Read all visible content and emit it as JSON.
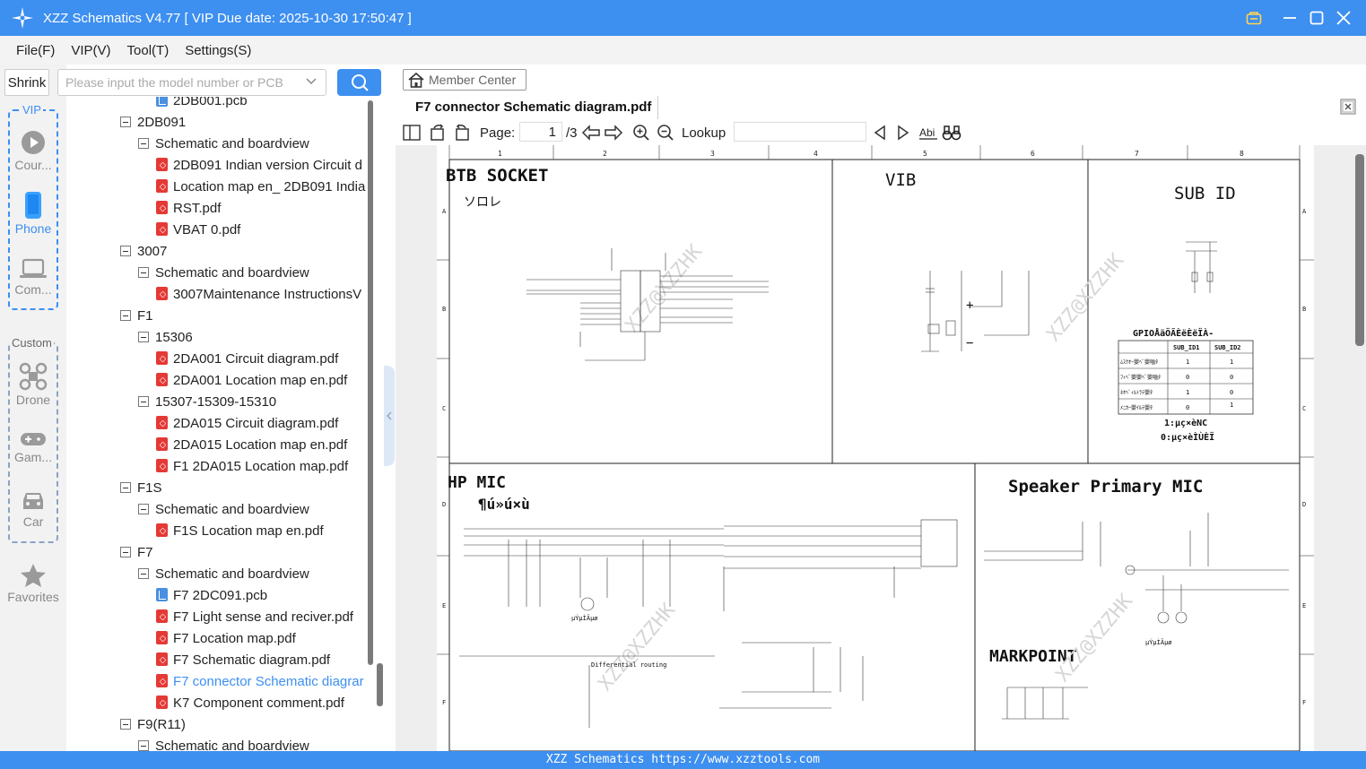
{
  "app": {
    "title": "XZZ Schematics V4.77 [ VIP Due date: 2025-10-30 17:50:47 ]",
    "status_text": "XZZ Schematics https://www.xzztools.com"
  },
  "menu": [
    "File(F)",
    "VIP(V)",
    "Tool(T)",
    "Settings(S)"
  ],
  "search": {
    "shrink_label": "Shrink",
    "placeholder": "Please input the model number or PCB"
  },
  "rail": {
    "vip_label": "VIP",
    "custom_label": "Custom",
    "items": [
      {
        "label": "Cour...",
        "icon": "play-icon"
      },
      {
        "label": "Phone",
        "icon": "phone-icon"
      },
      {
        "label": "Com...",
        "icon": "laptop-icon"
      },
      {
        "label": "Drone",
        "icon": "drone-icon"
      },
      {
        "label": "Gam...",
        "icon": "gamepad-icon"
      },
      {
        "label": "Car",
        "icon": "car-icon"
      },
      {
        "label": "Favorites",
        "icon": "star-icon"
      }
    ]
  },
  "tree": [
    {
      "label": "2DB001.pcb",
      "level": 2,
      "type": "pcb"
    },
    {
      "label": "2DB091",
      "level": 0,
      "type": "folder"
    },
    {
      "label": "Schematic and boardview",
      "level": 1,
      "type": "folder"
    },
    {
      "label": "2DB091 Indian version Circuit d",
      "level": 2,
      "type": "pdf"
    },
    {
      "label": "Location map en_ 2DB091 India",
      "level": 2,
      "type": "pdf"
    },
    {
      "label": "RST.pdf",
      "level": 2,
      "type": "pdf"
    },
    {
      "label": "VBAT 0.pdf",
      "level": 2,
      "type": "pdf"
    },
    {
      "label": "3007",
      "level": 0,
      "type": "folder"
    },
    {
      "label": "Schematic and boardview",
      "level": 1,
      "type": "folder"
    },
    {
      "label": "3007Maintenance InstructionsV",
      "level": 2,
      "type": "pdf"
    },
    {
      "label": "F1",
      "level": 0,
      "type": "folder"
    },
    {
      "label": "15306",
      "level": 1,
      "type": "folder"
    },
    {
      "label": "2DA001 Circuit diagram.pdf",
      "level": 2,
      "type": "pdf"
    },
    {
      "label": "2DA001 Location map en.pdf",
      "level": 2,
      "type": "pdf"
    },
    {
      "label": "15307-15309-15310",
      "level": 1,
      "type": "folder"
    },
    {
      "label": "2DA015 Circuit diagram.pdf",
      "level": 2,
      "type": "pdf"
    },
    {
      "label": "2DA015 Location map en.pdf",
      "level": 2,
      "type": "pdf"
    },
    {
      "label": "F1 2DA015 Location map.pdf",
      "level": 2,
      "type": "pdf"
    },
    {
      "label": "F1S",
      "level": 0,
      "type": "folder"
    },
    {
      "label": "Schematic and boardview",
      "level": 1,
      "type": "folder"
    },
    {
      "label": "F1S Location map en.pdf",
      "level": 2,
      "type": "pdf"
    },
    {
      "label": "F7",
      "level": 0,
      "type": "folder"
    },
    {
      "label": "Schematic and boardview",
      "level": 1,
      "type": "folder"
    },
    {
      "label": "F7 2DC091.pcb",
      "level": 2,
      "type": "pcb"
    },
    {
      "label": "F7 Light sense and reciver.pdf",
      "level": 2,
      "type": "pdf"
    },
    {
      "label": "F7 Location map.pdf",
      "level": 2,
      "type": "pdf"
    },
    {
      "label": "F7 Schematic diagram.pdf",
      "level": 2,
      "type": "pdf"
    },
    {
      "label": "F7 connector Schematic diagrar",
      "level": 2,
      "type": "pdf",
      "selected": true
    },
    {
      "label": "K7 Component comment.pdf",
      "level": 2,
      "type": "pdf"
    },
    {
      "label": "F9(R11)",
      "level": 0,
      "type": "folder"
    },
    {
      "label": "Schematic and boardview",
      "level": 1,
      "type": "folder"
    }
  ],
  "viewer": {
    "member_center": "Member Center",
    "doc_tab": "F7 connector Schematic diagram.pdf",
    "page_label": "Page:",
    "page_current": "1",
    "page_total": "/3",
    "lookup_label": "Lookup"
  },
  "schematic": {
    "titles": {
      "btb": "BTB SOCKET",
      "btb_sub": "ソロレ",
      "vib": "VIB",
      "subid": "SUB ID",
      "hpmic": "HP MIC",
      "hpmic_sub": "¶ú»ú×ù",
      "speaker": "Speaker Primary MIC",
      "markpoint": "MARKPOINT"
    },
    "col_labels": [
      "1",
      "2",
      "3",
      "4",
      "5",
      "6",
      "7",
      "8"
    ],
    "row_labels": [
      "A",
      "B",
      "C",
      "D",
      "E",
      "F"
    ],
    "gpio_title": "GPIOÅäÖÃÈëÈëÏÀ-",
    "gpio_headers": [
      "SUB_ID1",
      "SUB_ID2"
    ],
    "gpio_rows": [
      {
        "label": "ﾑｽｸｵｰ嬰ﾍﾞ嬰嚙ﾀ",
        "v1": "1",
        "v2": "1"
      },
      {
        "label": "ﾌｨﾍﾞ嬰嬰ﾍﾞ嬰嚙ﾀ",
        "v1": "0",
        "v2": "0"
      },
      {
        "label": "ﾈｵﾍﾞｨﾙﾄﾗﾃ嬰ﾀ",
        "v1": "1",
        "v2": "0"
      },
      {
        "label": "ﾒﾆｶｰ嬰ｲﾙﾃ嬰ﾀ",
        "v1": "0",
        "v2": "1"
      }
    ],
    "gpio_note1": "1:µç×èNC",
    "gpio_note2": "0:µç×èÌÙÈÏ",
    "watermark": "XZZ@XZZHK",
    "diff_routing": "Differential routing",
    "mic_label": "µÝµÌÂµø"
  }
}
